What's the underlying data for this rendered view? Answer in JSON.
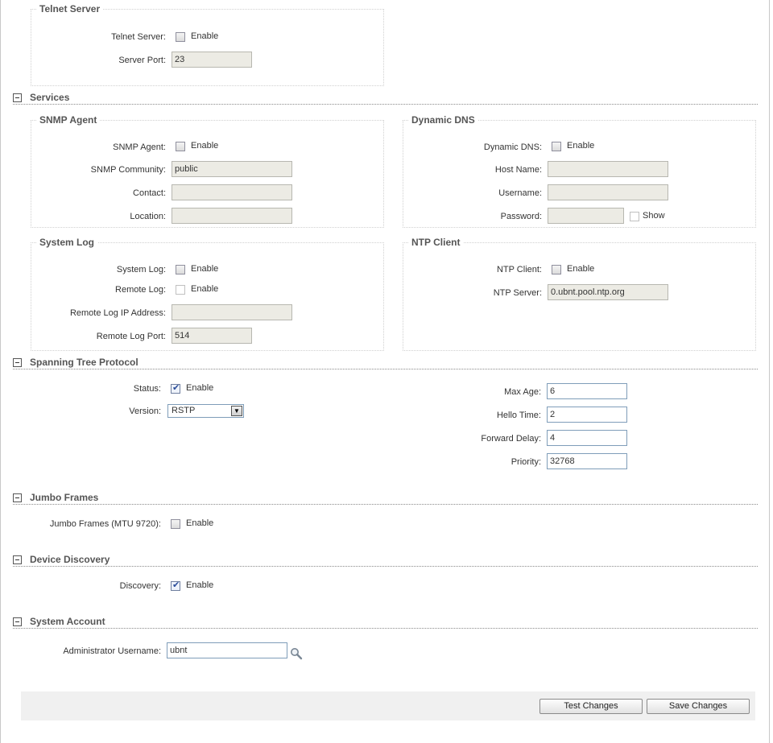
{
  "telnet": {
    "legend": "Telnet Server",
    "server_label": "Telnet Server:",
    "enable": "Enable",
    "port_label": "Server Port:",
    "port_value": "23"
  },
  "services": {
    "title": "Services",
    "snmp": {
      "legend": "SNMP Agent",
      "agent_label": "SNMP Agent:",
      "enable": "Enable",
      "community_label": "SNMP Community:",
      "community_value": "public",
      "contact_label": "Contact:",
      "contact_value": "",
      "location_label": "Location:",
      "location_value": ""
    },
    "ddns": {
      "legend": "Dynamic DNS",
      "ddns_label": "Dynamic DNS:",
      "enable": "Enable",
      "host_label": "Host Name:",
      "host_value": "",
      "user_label": "Username:",
      "user_value": "",
      "pass_label": "Password:",
      "pass_value": "",
      "show": "Show"
    },
    "syslog": {
      "legend": "System Log",
      "syslog_label": "System Log:",
      "enable": "Enable",
      "remote_label": "Remote Log:",
      "remote_enable": "Enable",
      "ip_label": "Remote Log IP Address:",
      "ip_value": "",
      "port_label": "Remote Log Port:",
      "port_value": "514"
    },
    "ntp": {
      "legend": "NTP Client",
      "client_label": "NTP Client:",
      "enable": "Enable",
      "server_label": "NTP Server:",
      "server_value": "0.ubnt.pool.ntp.org"
    }
  },
  "stp": {
    "title": "Spanning Tree Protocol",
    "status_label": "Status:",
    "enable": "Enable",
    "version_label": "Version:",
    "version_value": "RSTP",
    "max_age_label": "Max Age:",
    "max_age_value": "6",
    "hello_label": "Hello Time:",
    "hello_value": "2",
    "forward_label": "Forward Delay:",
    "forward_value": "4",
    "priority_label": "Priority:",
    "priority_value": "32768"
  },
  "jumbo": {
    "title": "Jumbo Frames",
    "label": "Jumbo Frames (MTU 9720):",
    "enable": "Enable"
  },
  "discovery": {
    "title": "Device Discovery",
    "label": "Discovery:",
    "enable": "Enable"
  },
  "account": {
    "title": "System Account",
    "admin_label": "Administrator Username:",
    "admin_value": "ubnt"
  },
  "buttons": {
    "test": "Test Changes",
    "save": "Save Changes"
  }
}
